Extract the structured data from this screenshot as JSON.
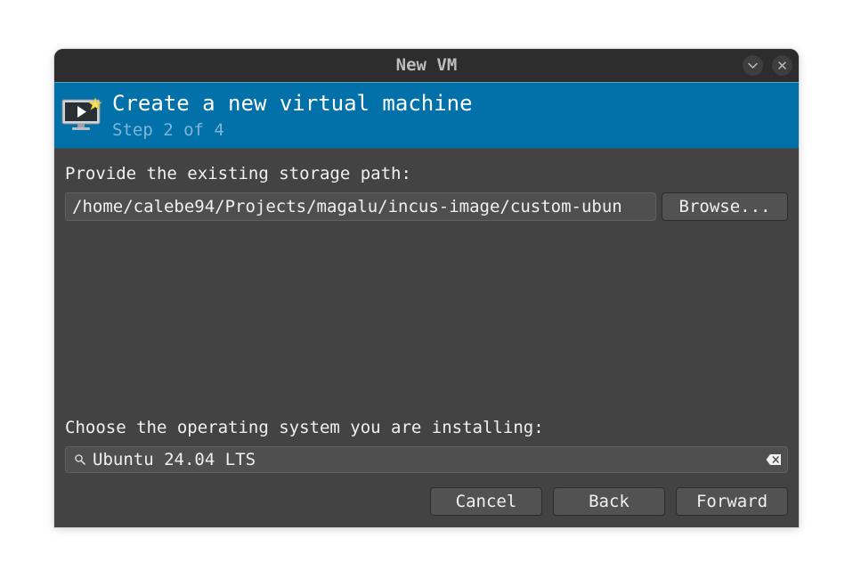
{
  "window": {
    "title": "New VM",
    "minimize_icon": "chevron-down-icon",
    "close_icon": "close-icon"
  },
  "banner": {
    "icon": "new-vm-icon",
    "title": "Create a new virtual machine",
    "subtitle": "Step 2 of 4",
    "background_color": "#0270a9"
  },
  "storage": {
    "label": "Provide the existing storage path:",
    "path_value": "/home/calebe94/Projects/magalu/incus-image/custom-ubun",
    "browse_label": "Browse..."
  },
  "os": {
    "label": "Choose the operating system you are installing:",
    "search_value": "Ubuntu 24.04 LTS",
    "search_icon": "search-icon",
    "clear_icon": "backspace-clear-icon"
  },
  "buttons": {
    "cancel": "Cancel",
    "back": "Back",
    "forward": "Forward"
  }
}
